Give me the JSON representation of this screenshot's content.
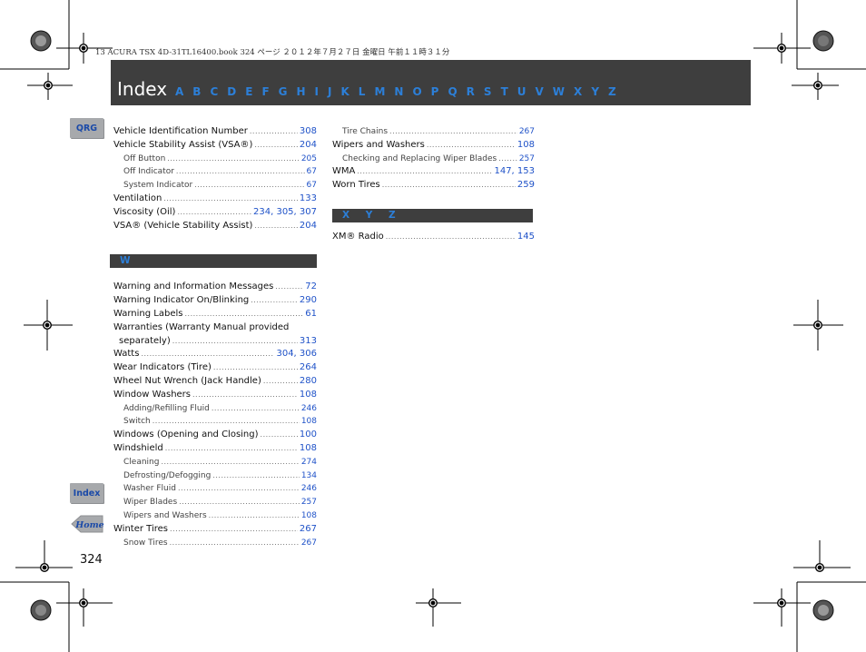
{
  "print_header": "13 ACURA TSX 4D-31TL16400.book  324 ページ  ２０１２年７月２７日  金曜日  午前１１時３１分",
  "header": {
    "title": "Index",
    "letters": [
      "A",
      "B",
      "C",
      "D",
      "E",
      "F",
      "G",
      "H",
      "I",
      "J",
      "K",
      "L",
      "M",
      "N",
      "O",
      "P",
      "Q",
      "R",
      "S",
      "T",
      "U",
      "V",
      "W",
      "X",
      "Y",
      "Z"
    ]
  },
  "side_tabs": {
    "qrg": "QRG",
    "index": "Index",
    "home": "Home"
  },
  "page_number": "324",
  "colors": {
    "bar": "#3e3e3e",
    "accent": "#2c7fd8",
    "link": "#1f52c8",
    "tab": "#a7a9ac"
  },
  "left_column": {
    "v_entries": [
      {
        "label": "Vehicle Identification Number",
        "pages": "308",
        "sub": false
      },
      {
        "label": "Vehicle Stability Assist (VSA®)",
        "pages": "204",
        "sub": false
      },
      {
        "label": "Off Button",
        "pages": "205",
        "sub": true
      },
      {
        "label": "Off Indicator",
        "pages": "67",
        "sub": true
      },
      {
        "label": "System Indicator",
        "pages": "67",
        "sub": true
      },
      {
        "label": "Ventilation",
        "pages": "133",
        "sub": false
      },
      {
        "label": "Viscosity (Oil)",
        "pages": "234, 305, 307",
        "sub": false
      },
      {
        "label": "VSA® (Vehicle Stability Assist)",
        "pages": "204",
        "sub": false
      }
    ],
    "w_heading": "W",
    "w_entries": [
      {
        "label": "Warning and Information Messages",
        "pages": "72",
        "sub": false
      },
      {
        "label": "Warning Indicator On/Blinking",
        "pages": "290",
        "sub": false
      },
      {
        "label": "Warning Labels",
        "pages": "61",
        "sub": false
      },
      {
        "label": "Warranties (Warranty Manual provided",
        "pages": "",
        "sub": false
      },
      {
        "label": "separately)",
        "pages": "313",
        "sub": false,
        "cont": true
      },
      {
        "label": "Watts",
        "pages": "304, 306",
        "sub": false
      },
      {
        "label": "Wear Indicators (Tire)",
        "pages": "264",
        "sub": false
      },
      {
        "label": "Wheel Nut Wrench (Jack Handle)",
        "pages": "280",
        "sub": false
      },
      {
        "label": "Window Washers",
        "pages": "108",
        "sub": false
      },
      {
        "label": "Adding/Refilling Fluid",
        "pages": "246",
        "sub": true
      },
      {
        "label": "Switch",
        "pages": "108",
        "sub": true
      },
      {
        "label": "Windows (Opening and Closing)",
        "pages": "100",
        "sub": false
      },
      {
        "label": "Windshield",
        "pages": "108",
        "sub": false
      },
      {
        "label": "Cleaning",
        "pages": "274",
        "sub": true
      },
      {
        "label": "Defrosting/Defogging",
        "pages": "134",
        "sub": true
      },
      {
        "label": "Washer Fluid",
        "pages": "246",
        "sub": true
      },
      {
        "label": "Wiper Blades",
        "pages": "257",
        "sub": true
      },
      {
        "label": "Wipers and Washers",
        "pages": "108",
        "sub": true
      },
      {
        "label": "Winter Tires",
        "pages": "267",
        "sub": false
      },
      {
        "label": "Snow Tires",
        "pages": "267",
        "sub": true
      }
    ]
  },
  "right_column": {
    "w_entries": [
      {
        "label": "Tire Chains",
        "pages": "267",
        "sub": true
      },
      {
        "label": "Wipers and Washers",
        "pages": "108",
        "sub": false
      },
      {
        "label": "Checking and Replacing Wiper Blades",
        "pages": "257",
        "sub": true
      },
      {
        "label": "WMA",
        "pages": "147, 153",
        "sub": false
      },
      {
        "label": "Worn Tires",
        "pages": "259",
        "sub": false
      }
    ],
    "xyz_heading": "X Y Z",
    "xyz_entries": [
      {
        "label": "XM® Radio",
        "pages": "145",
        "sub": false
      }
    ]
  }
}
